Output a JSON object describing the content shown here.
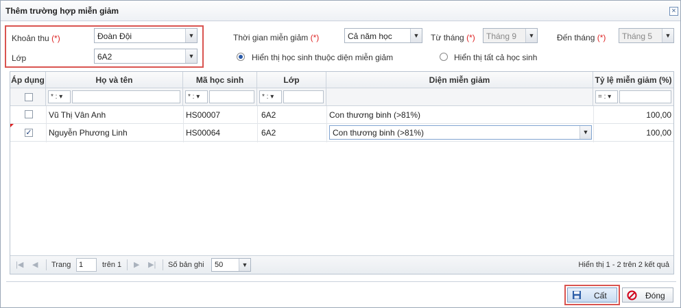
{
  "dialog": {
    "title": "Thêm trường hợp miễn giảm",
    "close_glyph": "×"
  },
  "form": {
    "khoan_thu_label": "Khoản thu",
    "khoan_thu_value": "Đoàn Đội",
    "lop_label": "Lớp",
    "lop_value": "6A2",
    "required_mark": "(*)",
    "thoi_gian_label": "Thời gian miễn giảm",
    "thoi_gian_value": "Cả năm học",
    "tu_thang_label": "Từ tháng",
    "tu_thang_value": "Tháng 9",
    "den_thang_label": "Đến tháng",
    "den_thang_value": "Tháng 5",
    "radio_mien_giam": "Hiển thị học sinh thuộc diện miễn giảm",
    "radio_tat_ca": "Hiển thị tất cả học sinh"
  },
  "grid": {
    "columns": [
      "Áp dụng",
      "Họ và tên",
      "Mã học sinh",
      "Lớp",
      "Diện miễn giảm",
      "Tỷ lệ miễn giảm (%)"
    ],
    "filter_ops": {
      "contains": "* :",
      "equals": "= :"
    },
    "rows": [
      {
        "ho_ten": "Vũ Thị Vân Anh",
        "ma_hs": "HS00007",
        "lop": "6A2",
        "dien": "Con thương binh (>81%)",
        "ty_le": "100,00",
        "checked": false
      },
      {
        "ho_ten": "Nguyễn Phương Linh",
        "ma_hs": "HS00064",
        "lop": "6A2",
        "dien": "Con thương binh (>81%)",
        "ty_le": "100,00",
        "checked": true
      }
    ]
  },
  "pager": {
    "page_label": "Trang",
    "page_value": "1",
    "of_label": "trên 1",
    "records_label": "Số bản ghi",
    "records_value": "50",
    "summary": "Hiển thị 1 - 2 trên 2 kết quả"
  },
  "buttons": {
    "save": "Cất",
    "close": "Đóng"
  },
  "colors": {
    "highlight": "#d9534f",
    "required": "#dd2222"
  }
}
